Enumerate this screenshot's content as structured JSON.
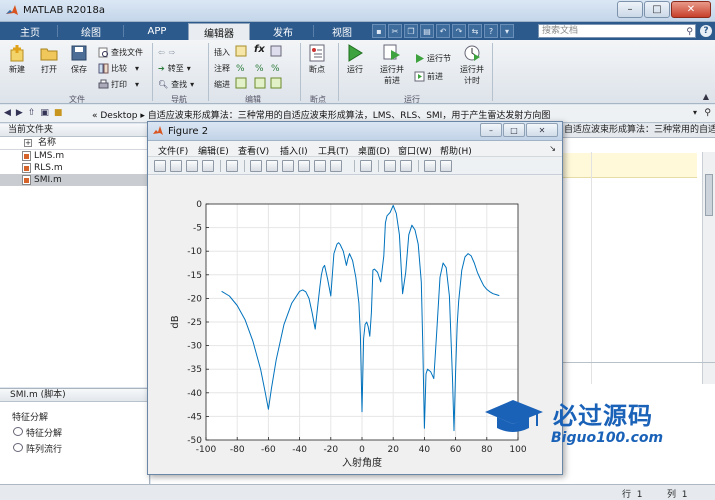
{
  "app": {
    "title": "MATLAB R2018a"
  },
  "tabs": [
    {
      "label": "主页",
      "active": false
    },
    {
      "label": "绘图",
      "active": false
    },
    {
      "label": "APP",
      "active": false
    },
    {
      "label": "编辑器",
      "active": true
    },
    {
      "label": "发布",
      "active": false
    },
    {
      "label": "视图",
      "active": false
    }
  ],
  "search": {
    "placeholder": "搜索文档"
  },
  "toolstrip": {
    "file": {
      "new": "新建",
      "open": "打开",
      "save": "保存",
      "find_files": "查找文件",
      "compare": "比较",
      "print": "打印",
      "group": "文件"
    },
    "nav": {
      "goto": "转至",
      "find": "查找",
      "group": "导航"
    },
    "edit": {
      "insert": "插入",
      "comment": "注释",
      "indent": "缩进",
      "fx": "fx",
      "group": "编辑"
    },
    "breakpoints": {
      "label": "断点",
      "group": "断点"
    },
    "run": {
      "run": "运行",
      "run_advance": "运行并\n前进",
      "run_section": "运行节",
      "advance": "前进",
      "run_time": "运行并\n计时",
      "group": "运行"
    }
  },
  "address": {
    "path": "«  Desktop  ▸  自适应波束形成算法：三种常用的自适应波束形成算法，LMS、RLS、SMI，用于产生雷达发射方向图"
  },
  "current_folder": {
    "title": "当前文件夹",
    "column": "名称",
    "files": [
      {
        "name": "LMS.m",
        "selected": false
      },
      {
        "name": "RLS.m",
        "selected": false
      },
      {
        "name": "SMI.m",
        "selected": true
      }
    ]
  },
  "details": {
    "title": "SMI.m  (脚本)",
    "section": "特征分解",
    "items": [
      "特征分解",
      "阵列流行"
    ]
  },
  "editor": {
    "tab_text": "自适应波束形成算法：三种常用的自适应波束形成算法，LM..."
  },
  "status": {
    "row_label": "行",
    "row": "1",
    "col_label": "列",
    "col": "1"
  },
  "figure": {
    "title": "Figure 2",
    "menu": [
      "文件(F)",
      "编辑(E)",
      "查看(V)",
      "插入(I)",
      "工具(T)",
      "桌面(D)",
      "窗口(W)",
      "帮助(H)"
    ]
  },
  "chart_data": {
    "type": "line",
    "title": "",
    "xlabel": "入射角度",
    "ylabel": "dB",
    "xlim": [
      -100,
      100
    ],
    "ylim": [
      -50,
      0
    ],
    "xticks": [
      -100,
      -80,
      -60,
      -40,
      -20,
      0,
      20,
      40,
      60,
      80,
      100
    ],
    "yticks": [
      0,
      -5,
      -10,
      -15,
      -20,
      -25,
      -30,
      -35,
      -40,
      -45,
      -50
    ],
    "grid": true,
    "color": "#0072bd",
    "series": [
      {
        "x": [
          -90,
          -85,
          -80,
          -75,
          -70,
          -65,
          -62,
          -60,
          -58,
          -55,
          -50,
          -45,
          -40,
          -38,
          -36,
          -34,
          -32,
          -30,
          -28,
          -27,
          -26,
          -25,
          -24,
          -22,
          -20,
          -18,
          -16,
          -15,
          -14,
          -12,
          -10,
          -9,
          -8,
          -6,
          -4,
          -2,
          -1,
          0,
          1,
          2,
          3,
          4,
          5,
          6,
          7,
          8,
          10,
          12,
          14,
          15,
          16,
          18,
          20,
          22,
          24,
          26,
          28,
          30,
          32,
          34,
          36,
          38,
          39,
          40,
          41,
          42,
          44,
          46,
          48,
          50,
          52,
          54,
          56,
          58,
          59,
          60,
          61,
          62,
          64,
          66,
          68,
          70,
          72,
          74,
          76,
          78,
          80,
          82,
          84,
          86,
          88
        ],
        "y": [
          -18.5,
          -19.5,
          -21.5,
          -24.5,
          -29,
          -35,
          -40,
          -43.5,
          -39,
          -33,
          -25.5,
          -21,
          -18.5,
          -18.2,
          -18.6,
          -20,
          -23,
          -26.5,
          -20.5,
          -17.5,
          -15,
          -13.5,
          -13,
          -16,
          -19.5,
          -10.5,
          -8.5,
          -8.2,
          -8.6,
          -10,
          -13,
          -11.5,
          -10.5,
          -12,
          -15.5,
          -21,
          -28,
          -44,
          -28.5,
          -25.5,
          -25,
          -26,
          -28,
          -23,
          -14,
          -13.8,
          -14.5,
          -16.5,
          -11,
          -4,
          -2.5,
          -1.8,
          -0.3,
          -2,
          -6.5,
          -19,
          -14.5,
          -6.5,
          -4.5,
          -5.5,
          -8.5,
          -16.5,
          -30,
          -47.5,
          -36,
          -35,
          -35.5,
          -37,
          -26.5,
          -15.5,
          -12.5,
          -13.5,
          -19.5,
          -37,
          -48,
          -35.5,
          -25.5,
          -20.5,
          -14,
          -11.2,
          -10.5,
          -11,
          -12.5,
          -14.5,
          -16,
          -17.3,
          -18.1,
          -18.6,
          -19,
          -19.2,
          -19.4
        ]
      }
    ]
  },
  "watermark": {
    "title": "必过源码",
    "url": "Biguo100.com"
  }
}
